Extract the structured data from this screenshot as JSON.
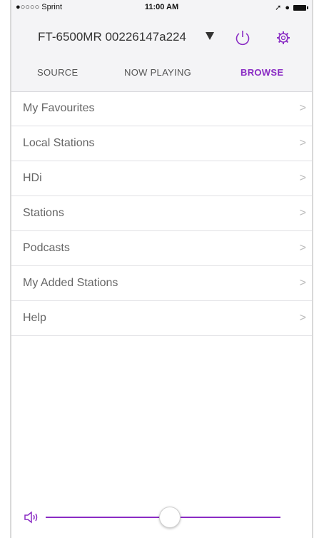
{
  "status_bar": {
    "carrier": "●○○○○ Sprint",
    "time": "11:00 AM"
  },
  "header": {
    "device_name": "FT-6500MR 00226147a224"
  },
  "tabs": [
    {
      "label": "SOURCE"
    },
    {
      "label": "NOW PLAYING"
    },
    {
      "label": "BROWSE"
    }
  ],
  "menu": {
    "items": [
      {
        "label": "My Favourites"
      },
      {
        "label": "Local Stations"
      },
      {
        "label": "HDi"
      },
      {
        "label": "Stations"
      },
      {
        "label": "Podcasts"
      },
      {
        "label": "My Added Stations"
      },
      {
        "label": "Help"
      }
    ],
    "chevron": ">"
  },
  "volume": {
    "level": 0.53
  },
  "colors": {
    "accent": "#8a2cc4",
    "header_bg": "#f4f4f6"
  }
}
